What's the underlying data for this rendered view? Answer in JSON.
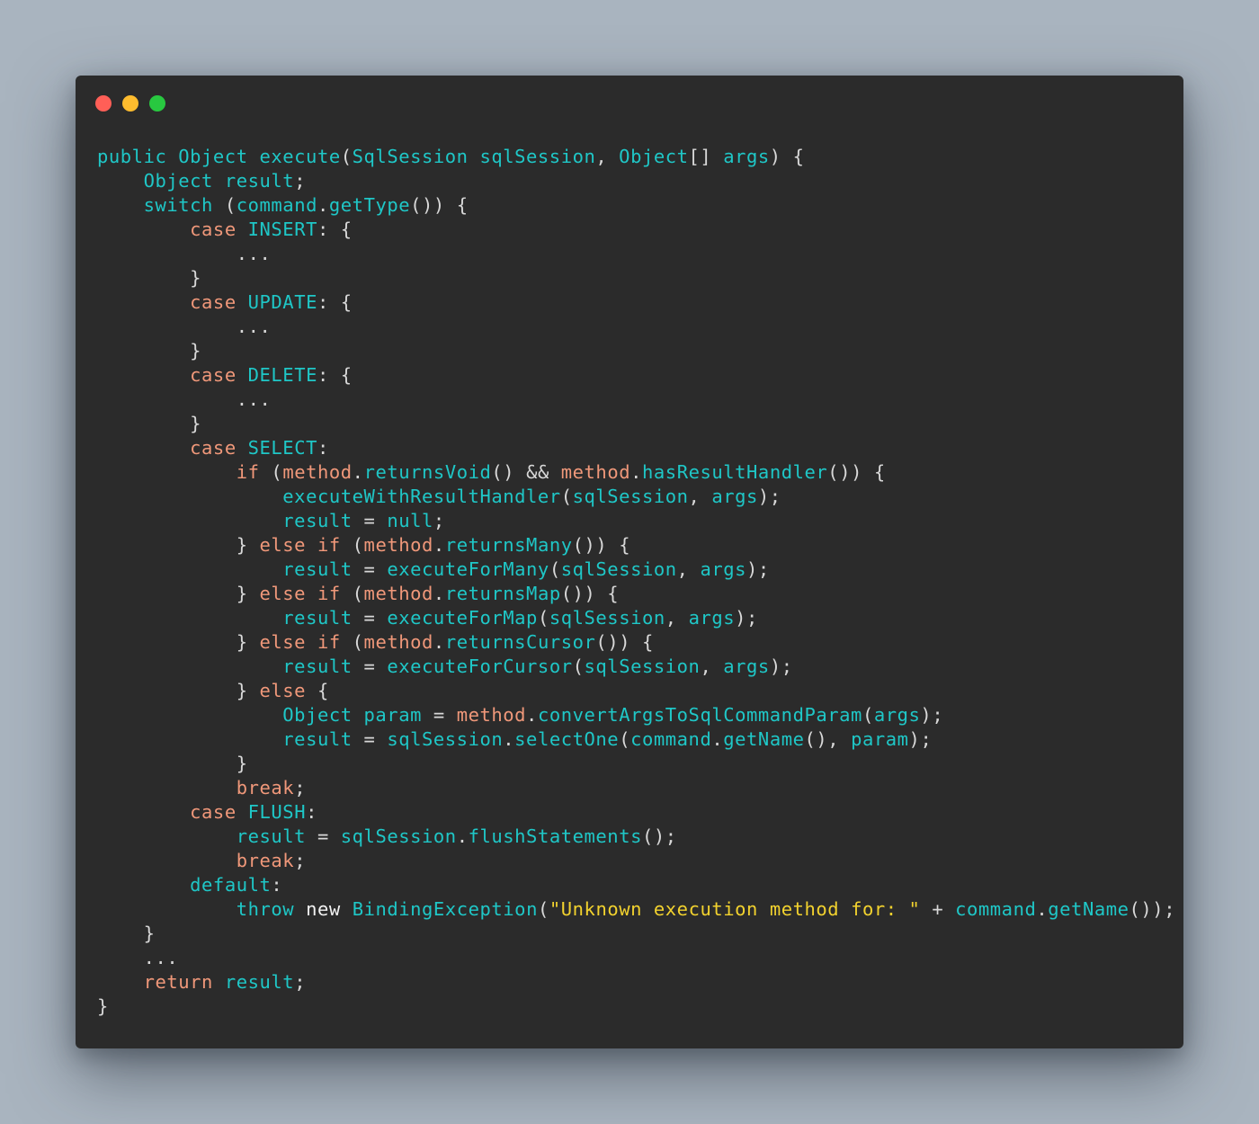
{
  "window": {
    "controls": [
      {
        "name": "close",
        "color": "#ff5f57"
      },
      {
        "name": "minimize",
        "color": "#febc2e"
      },
      {
        "name": "maximize",
        "color": "#28c840"
      }
    ]
  },
  "theme": {
    "background": "#a9b4bf",
    "editor_background": "#2b2b2b",
    "token_colors": {
      "plain": "#d8d8d8",
      "ident": "#1fc7c7",
      "kw": "#f0987a",
      "str": "#f2d22e",
      "white": "#f2f2f2"
    }
  },
  "code": {
    "language": "java",
    "lines": [
      [
        [
          "ident",
          "public Object execute"
        ],
        [
          "plain",
          "("
        ],
        [
          "ident",
          "SqlSession sqlSession"
        ],
        [
          "plain",
          ", "
        ],
        [
          "ident",
          "Object"
        ],
        [
          "plain",
          "[] "
        ],
        [
          "ident",
          "args"
        ],
        [
          "plain",
          ") {"
        ]
      ],
      [
        [
          "plain",
          "    "
        ],
        [
          "ident",
          "Object result"
        ],
        [
          "plain",
          ";"
        ]
      ],
      [
        [
          "plain",
          "    "
        ],
        [
          "ident",
          "switch"
        ],
        [
          "plain",
          " ("
        ],
        [
          "ident",
          "command"
        ],
        [
          "plain",
          "."
        ],
        [
          "ident",
          "getType"
        ],
        [
          "plain",
          "()) {"
        ]
      ],
      [
        [
          "plain",
          "        "
        ],
        [
          "kw",
          "case"
        ],
        [
          "plain",
          " "
        ],
        [
          "ident",
          "INSERT"
        ],
        [
          "plain",
          ": {"
        ]
      ],
      [
        [
          "plain",
          "            ..."
        ]
      ],
      [
        [
          "plain",
          "        }"
        ]
      ],
      [
        [
          "plain",
          "        "
        ],
        [
          "kw",
          "case"
        ],
        [
          "plain",
          " "
        ],
        [
          "ident",
          "UPDATE"
        ],
        [
          "plain",
          ": {"
        ]
      ],
      [
        [
          "plain",
          "            ..."
        ]
      ],
      [
        [
          "plain",
          "        }"
        ]
      ],
      [
        [
          "plain",
          "        "
        ],
        [
          "kw",
          "case"
        ],
        [
          "plain",
          " "
        ],
        [
          "ident",
          "DELETE"
        ],
        [
          "plain",
          ": {"
        ]
      ],
      [
        [
          "plain",
          "            ..."
        ]
      ],
      [
        [
          "plain",
          "        }"
        ]
      ],
      [
        [
          "plain",
          "        "
        ],
        [
          "kw",
          "case"
        ],
        [
          "plain",
          " "
        ],
        [
          "ident",
          "SELECT"
        ],
        [
          "plain",
          ":"
        ]
      ],
      [
        [
          "plain",
          "            "
        ],
        [
          "kw",
          "if"
        ],
        [
          "plain",
          " ("
        ],
        [
          "kw",
          "method"
        ],
        [
          "plain",
          "."
        ],
        [
          "ident",
          "returnsVoid"
        ],
        [
          "plain",
          "() && "
        ],
        [
          "kw",
          "method"
        ],
        [
          "plain",
          "."
        ],
        [
          "ident",
          "hasResultHandler"
        ],
        [
          "plain",
          "()) {"
        ]
      ],
      [
        [
          "plain",
          "                "
        ],
        [
          "ident",
          "executeWithResultHandler"
        ],
        [
          "plain",
          "("
        ],
        [
          "ident",
          "sqlSession"
        ],
        [
          "plain",
          ", "
        ],
        [
          "ident",
          "args"
        ],
        [
          "plain",
          ");"
        ]
      ],
      [
        [
          "plain",
          "                "
        ],
        [
          "ident",
          "result"
        ],
        [
          "plain",
          " = "
        ],
        [
          "ident",
          "null"
        ],
        [
          "plain",
          ";"
        ]
      ],
      [
        [
          "plain",
          "            } "
        ],
        [
          "kw",
          "else if"
        ],
        [
          "plain",
          " ("
        ],
        [
          "kw",
          "method"
        ],
        [
          "plain",
          "."
        ],
        [
          "ident",
          "returnsMany"
        ],
        [
          "plain",
          "()) {"
        ]
      ],
      [
        [
          "plain",
          "                "
        ],
        [
          "ident",
          "result"
        ],
        [
          "plain",
          " = "
        ],
        [
          "ident",
          "executeForMany"
        ],
        [
          "plain",
          "("
        ],
        [
          "ident",
          "sqlSession"
        ],
        [
          "plain",
          ", "
        ],
        [
          "ident",
          "args"
        ],
        [
          "plain",
          ");"
        ]
      ],
      [
        [
          "plain",
          "            } "
        ],
        [
          "kw",
          "else if"
        ],
        [
          "plain",
          " ("
        ],
        [
          "kw",
          "method"
        ],
        [
          "plain",
          "."
        ],
        [
          "ident",
          "returnsMap"
        ],
        [
          "plain",
          "()) {"
        ]
      ],
      [
        [
          "plain",
          "                "
        ],
        [
          "ident",
          "result"
        ],
        [
          "plain",
          " = "
        ],
        [
          "ident",
          "executeForMap"
        ],
        [
          "plain",
          "("
        ],
        [
          "ident",
          "sqlSession"
        ],
        [
          "plain",
          ", "
        ],
        [
          "ident",
          "args"
        ],
        [
          "plain",
          ");"
        ]
      ],
      [
        [
          "plain",
          "            } "
        ],
        [
          "kw",
          "else if"
        ],
        [
          "plain",
          " ("
        ],
        [
          "kw",
          "method"
        ],
        [
          "plain",
          "."
        ],
        [
          "ident",
          "returnsCursor"
        ],
        [
          "plain",
          "()) {"
        ]
      ],
      [
        [
          "plain",
          "                "
        ],
        [
          "ident",
          "result"
        ],
        [
          "plain",
          " = "
        ],
        [
          "ident",
          "executeForCursor"
        ],
        [
          "plain",
          "("
        ],
        [
          "ident",
          "sqlSession"
        ],
        [
          "plain",
          ", "
        ],
        [
          "ident",
          "args"
        ],
        [
          "plain",
          ");"
        ]
      ],
      [
        [
          "plain",
          "            } "
        ],
        [
          "kw",
          "else"
        ],
        [
          "plain",
          " {"
        ]
      ],
      [
        [
          "plain",
          "                "
        ],
        [
          "ident",
          "Object param"
        ],
        [
          "plain",
          " = "
        ],
        [
          "kw",
          "method"
        ],
        [
          "plain",
          "."
        ],
        [
          "ident",
          "convertArgsToSqlCommandParam"
        ],
        [
          "plain",
          "("
        ],
        [
          "ident",
          "args"
        ],
        [
          "plain",
          ");"
        ]
      ],
      [
        [
          "plain",
          "                "
        ],
        [
          "ident",
          "result"
        ],
        [
          "plain",
          " = "
        ],
        [
          "ident",
          "sqlSession"
        ],
        [
          "plain",
          "."
        ],
        [
          "ident",
          "selectOne"
        ],
        [
          "plain",
          "("
        ],
        [
          "ident",
          "command"
        ],
        [
          "plain",
          "."
        ],
        [
          "ident",
          "getName"
        ],
        [
          "plain",
          "(), "
        ],
        [
          "ident",
          "param"
        ],
        [
          "plain",
          ");"
        ]
      ],
      [
        [
          "plain",
          "            }"
        ]
      ],
      [
        [
          "plain",
          "            "
        ],
        [
          "kw",
          "break"
        ],
        [
          "plain",
          ";"
        ]
      ],
      [
        [
          "plain",
          "        "
        ],
        [
          "kw",
          "case"
        ],
        [
          "plain",
          " "
        ],
        [
          "ident",
          "FLUSH"
        ],
        [
          "plain",
          ":"
        ]
      ],
      [
        [
          "plain",
          "            "
        ],
        [
          "ident",
          "result"
        ],
        [
          "plain",
          " = "
        ],
        [
          "ident",
          "sqlSession"
        ],
        [
          "plain",
          "."
        ],
        [
          "ident",
          "flushStatements"
        ],
        [
          "plain",
          "();"
        ]
      ],
      [
        [
          "plain",
          "            "
        ],
        [
          "kw",
          "break"
        ],
        [
          "plain",
          ";"
        ]
      ],
      [
        [
          "plain",
          "        "
        ],
        [
          "ident",
          "default"
        ],
        [
          "plain",
          ":"
        ]
      ],
      [
        [
          "plain",
          "            "
        ],
        [
          "ident",
          "throw"
        ],
        [
          "plain",
          " "
        ],
        [
          "white",
          "new"
        ],
        [
          "plain",
          " "
        ],
        [
          "ident",
          "BindingException"
        ],
        [
          "plain",
          "("
        ],
        [
          "str",
          "\"Unknown execution method for: \""
        ],
        [
          "plain",
          " + "
        ],
        [
          "ident",
          "command"
        ],
        [
          "plain",
          "."
        ],
        [
          "ident",
          "getName"
        ],
        [
          "plain",
          "());"
        ]
      ],
      [
        [
          "plain",
          "    }"
        ]
      ],
      [
        [
          "plain",
          "    ..."
        ]
      ],
      [
        [
          "plain",
          "    "
        ],
        [
          "kw",
          "return"
        ],
        [
          "plain",
          " "
        ],
        [
          "ident",
          "result"
        ],
        [
          "plain",
          ";"
        ]
      ],
      [
        [
          "plain",
          "}"
        ]
      ]
    ]
  }
}
